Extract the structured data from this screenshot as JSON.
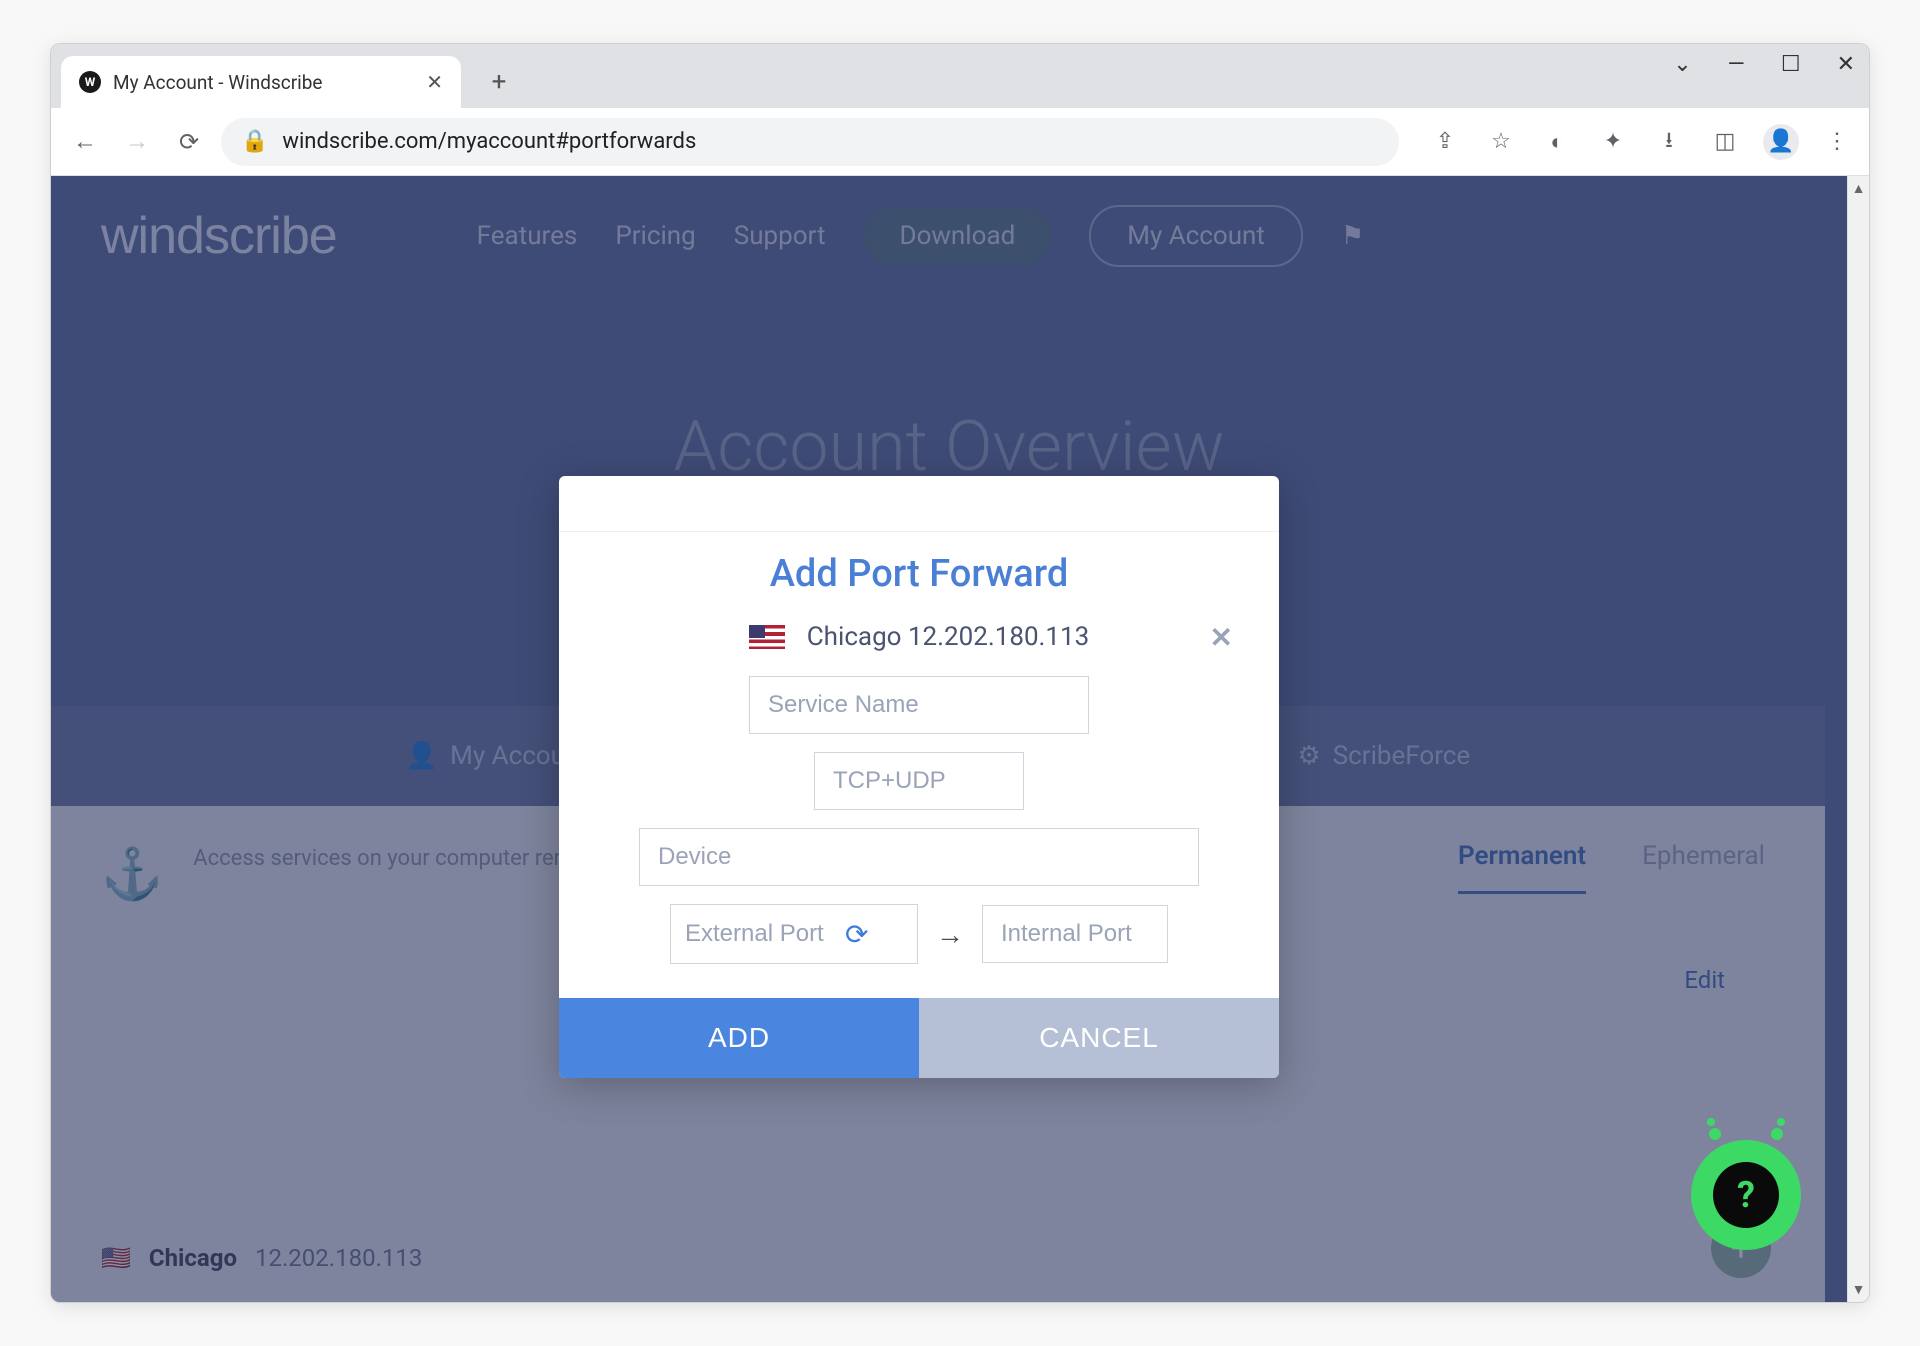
{
  "browser": {
    "tab_title": "My Account - Windscribe",
    "url": "windscribe.com/myaccount#portforwards"
  },
  "site": {
    "logo": "windscribe",
    "nav": {
      "features": "Features",
      "pricing": "Pricing",
      "support": "Support",
      "download": "Download",
      "my_account": "My Account"
    },
    "hero": "Account Overview"
  },
  "account_tabs": {
    "my_account": "My Account",
    "scribeforce": "ScribeForce"
  },
  "port_forward_panel": {
    "description": "Access services on your computer remotely, while connected to Windscribe",
    "permanent": "Permanent",
    "ephemeral": "Ephemeral",
    "edit": "Edit",
    "location_city": "Chicago",
    "location_ip": "12.202.180.113"
  },
  "modal": {
    "title": "Add Port Forward",
    "location": "Chicago 12.202.180.113",
    "service_placeholder": "Service Name",
    "protocol_placeholder": "TCP+UDP",
    "device_placeholder": "Device",
    "external_port_placeholder": "External Port",
    "internal_port_placeholder": "Internal Port",
    "add": "ADD",
    "cancel": "CANCEL"
  }
}
